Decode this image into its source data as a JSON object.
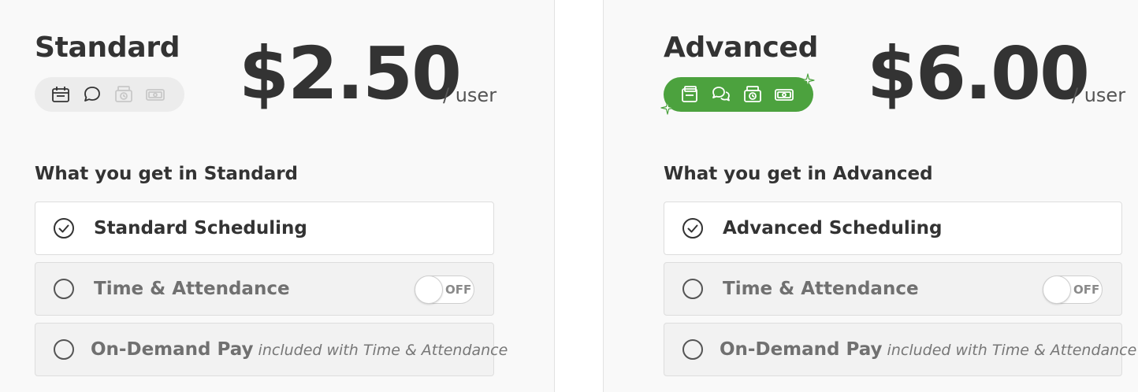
{
  "plans": [
    {
      "name": "Standard",
      "price": "$2.50",
      "unit": "/ user",
      "badge_icons": [
        "scheduling-icon",
        "messaging-icon",
        "time-clock-icon",
        "pay-icon"
      ],
      "section_title": "What you get in Standard",
      "features": [
        {
          "label": "Standard Scheduling",
          "state": "included"
        },
        {
          "label": "Time & Attendance",
          "state": "optional",
          "toggle": "OFF"
        },
        {
          "label": "On-Demand Pay",
          "note": "included with Time & Attendance",
          "state": "optional"
        }
      ]
    },
    {
      "name": "Advanced",
      "price": "$6.00",
      "unit": "/ user",
      "badge_icons": [
        "scheduling-icon",
        "messaging-icon",
        "time-clock-icon",
        "pay-icon"
      ],
      "section_title": "What you get in Advanced",
      "features": [
        {
          "label": "Advanced Scheduling",
          "state": "included"
        },
        {
          "label": "Time & Attendance",
          "state": "optional",
          "toggle": "OFF"
        },
        {
          "label": "On-Demand Pay",
          "note": "included with Time & Attendance",
          "state": "optional"
        }
      ]
    }
  ],
  "colors": {
    "accent_green": "#4ca23e",
    "text_dark": "#333333",
    "text_muted": "#707070",
    "card_border": "#dddddd"
  }
}
